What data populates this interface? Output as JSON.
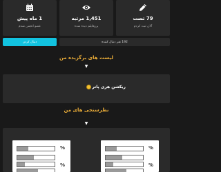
{
  "stats": [
    {
      "icon": "calendar-icon",
      "value": "1 ماه پیش",
      "caption": "عضو انجمن شدم"
    },
    {
      "icon": "eye-icon",
      "value": "1,451 مرتبه",
      "caption": "پروفایلم دیده شده"
    },
    {
      "icon": "pencil-icon",
      "value": "79 تست",
      "caption": "آلان ثبت کردم"
    }
  ],
  "actions": {
    "follow_label": "دنبال کردن",
    "followers_text": "192 نفر دنبال کننده"
  },
  "favorites": {
    "title": "لیست های برگزیده من",
    "items": [
      {
        "label": "ریکشن هری پاتر",
        "icon": "smiley-icon"
      }
    ]
  },
  "polls": {
    "title": "نظرسنجی های من",
    "cards": [
      {
        "percent_symbol": "%",
        "fills": [
          0.3,
          0.45,
          0.2,
          0.55
        ]
      },
      {
        "percent_symbol": "%",
        "fills": [
          0.3,
          0.45,
          0.2,
          0.55
        ]
      }
    ]
  },
  "colors": {
    "accent": "#12c3e0",
    "section_title": "#e8ab38",
    "card_bg": "#2a2a2a",
    "page_bg": "#191919"
  }
}
